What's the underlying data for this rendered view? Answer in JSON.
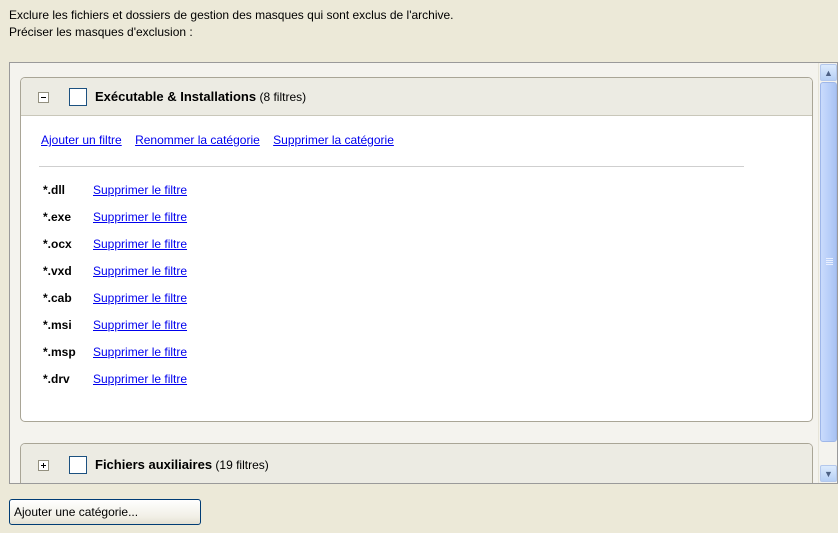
{
  "intro": {
    "line1": "Exclure les fichiers et dossiers de gestion des masques qui sont exclus de l'archive.",
    "line2": "Préciser les masques d'exclusion :"
  },
  "categories": [
    {
      "name": "Exécutable & Installations",
      "count": " (8 filtres)",
      "expanded": true,
      "actions": {
        "add_filter": "Ajouter un filtre",
        "rename": "Renommer la catégorie",
        "delete": "Supprimer la catégorie"
      },
      "filters": [
        {
          "mask": "*.dll",
          "action": "Supprimer le filtre"
        },
        {
          "mask": "*.exe",
          "action": "Supprimer le filtre"
        },
        {
          "mask": "*.ocx",
          "action": "Supprimer le filtre"
        },
        {
          "mask": "*.vxd",
          "action": "Supprimer le filtre"
        },
        {
          "mask": "*.cab",
          "action": "Supprimer le filtre"
        },
        {
          "mask": "*.msi",
          "action": "Supprimer le filtre"
        },
        {
          "mask": "*.msp",
          "action": "Supprimer le filtre"
        },
        {
          "mask": "*.drv",
          "action": "Supprimer le filtre"
        }
      ]
    },
    {
      "name": "Fichiers auxiliaires",
      "count": " (19 filtres)",
      "expanded": false
    }
  ],
  "add_category_button": "Ajouter une catégorie...",
  "colors": {
    "window_bg": "#ece9d8",
    "link": "#0000ee",
    "header_bg": "#ecebe3",
    "scrollbar": "#b6cdf8"
  }
}
